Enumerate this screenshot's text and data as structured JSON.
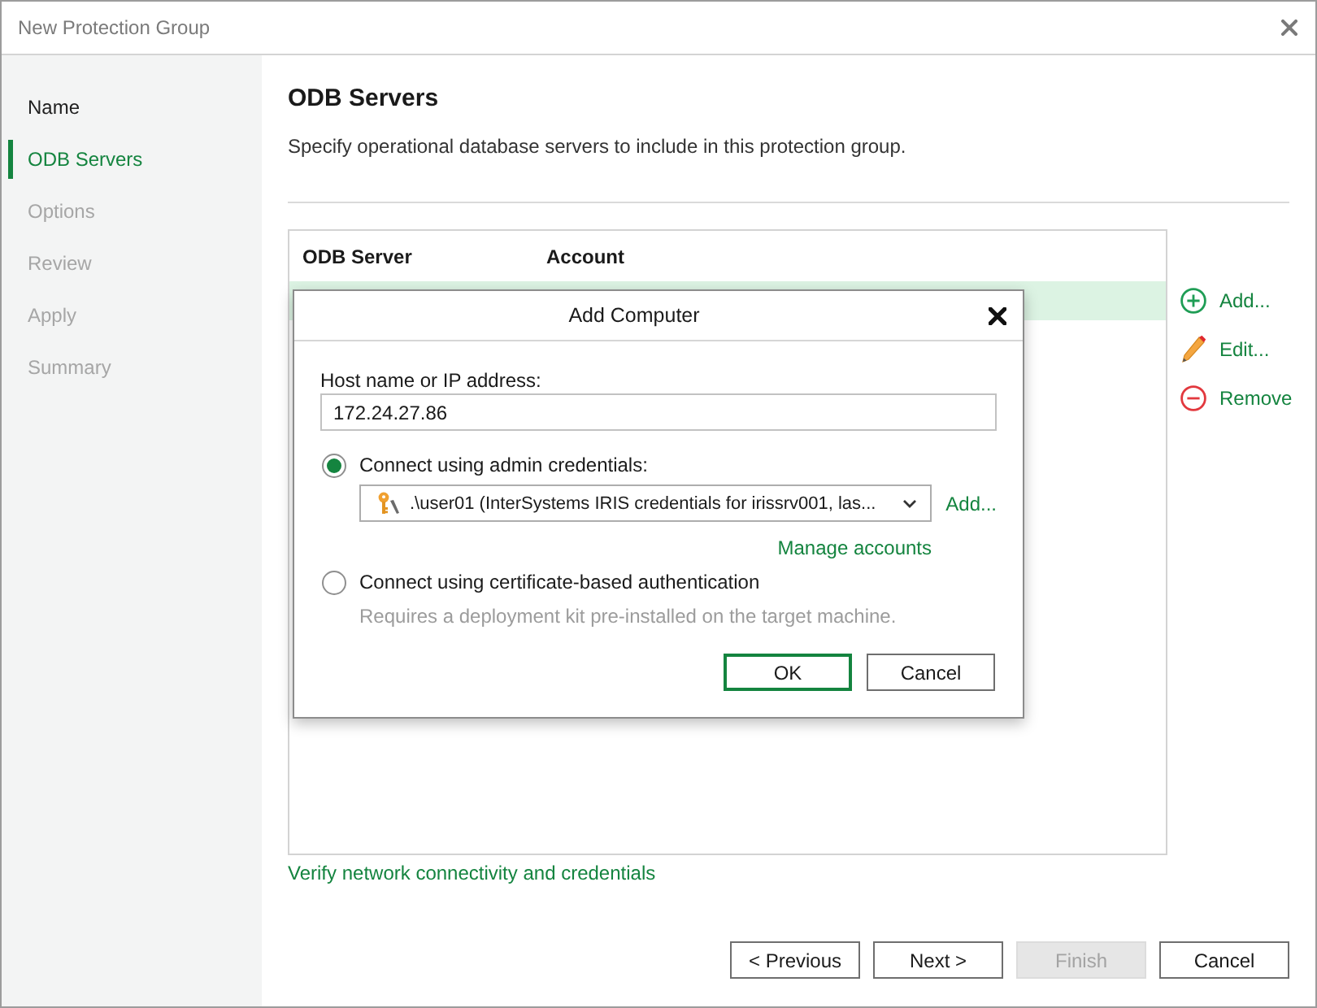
{
  "window": {
    "title": "New Protection Group"
  },
  "sidebar": {
    "items": [
      {
        "label": "Name",
        "selected": false,
        "disabled": false
      },
      {
        "label": "ODB Servers",
        "selected": true,
        "disabled": false
      },
      {
        "label": "Options",
        "selected": false,
        "disabled": true
      },
      {
        "label": "Review",
        "selected": false,
        "disabled": true
      },
      {
        "label": "Apply",
        "selected": false,
        "disabled": true
      },
      {
        "label": "Summary",
        "selected": false,
        "disabled": true
      }
    ]
  },
  "page": {
    "title": "ODB Servers",
    "description": "Specify operational database servers to include in this protection group."
  },
  "table": {
    "columns": [
      "ODB Server",
      "Account"
    ],
    "rows": [
      {
        "selected": true
      }
    ]
  },
  "actions": [
    {
      "label": "Add...",
      "kind": "add"
    },
    {
      "label": "Edit...",
      "kind": "edit"
    },
    {
      "label": "Remove",
      "kind": "remove"
    }
  ],
  "verify_link": "Verify network connectivity and credentials",
  "buttons": [
    {
      "label": "< Previous",
      "disabled": false
    },
    {
      "label": "Next >",
      "disabled": false
    },
    {
      "label": "Finish",
      "disabled": true
    },
    {
      "label": "Cancel",
      "disabled": false
    }
  ],
  "dialog": {
    "title": "Add Computer",
    "host_label": "Host name or IP address:",
    "host_value": "172.24.27.86",
    "options": [
      {
        "kind": "credentials",
        "label": "Connect using admin credentials:",
        "selected": true,
        "account": {
          "value": ".\\user01 (InterSystems IRIS credentials for irissrv001, las...",
          "add_link": "Add...",
          "manage_link": "Manage accounts"
        }
      },
      {
        "kind": "certificate",
        "label": "Connect using certificate-based authentication",
        "selected": false,
        "note": "Requires a deployment kit pre-installed on the target machine."
      }
    ],
    "buttons": [
      {
        "label": "OK",
        "default": true
      },
      {
        "label": "Cancel",
        "default": false
      }
    ]
  }
}
